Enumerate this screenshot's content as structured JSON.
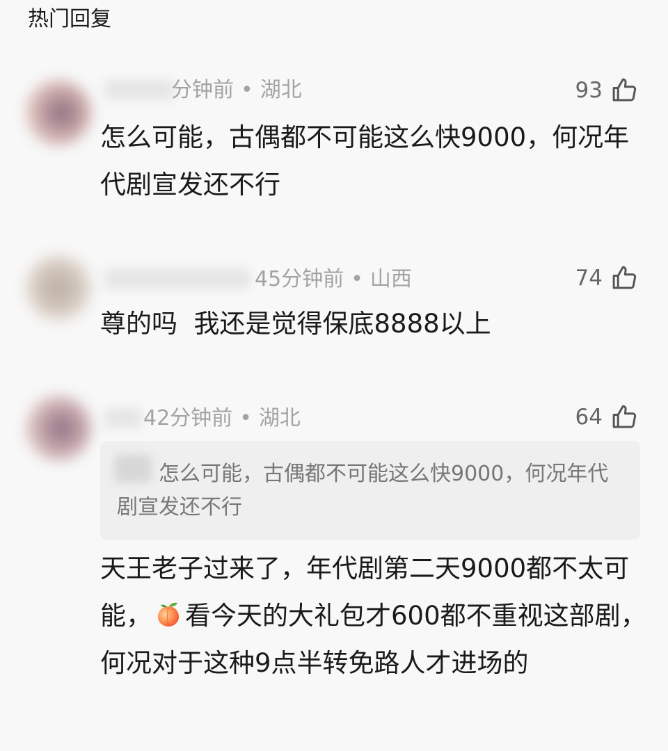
{
  "section_title": "热门回复",
  "comments": [
    {
      "time": "分钟前",
      "location": "湖北",
      "separator": "•",
      "likes": "93",
      "text": "怎么可能，古偶都不可能这么快9000，何况年代剧宣发还不行"
    },
    {
      "time": "45分钟前",
      "location": "山西",
      "separator": "•",
      "likes": "74",
      "text": "尊的吗  我还是觉得保底8888以上"
    },
    {
      "time": "42分钟前",
      "location": "湖北",
      "separator": "•",
      "likes": "64",
      "quote": "怎么可能，古偶都不可能这么快9000，何况年代剧宣发还不行",
      "text_part1": "天王老子过来了，年代剧第二天9000都不太可能，",
      "text_part2": "看今天的大礼包才600都不重视这部剧，何况对于这种9点半转免路人才进场的",
      "emoji": "peach-emoji"
    }
  ],
  "colors": {
    "meta_text": "#a3a3a3",
    "like_icon": "#555555",
    "quote_bg": "#efefef"
  },
  "icons": {
    "like": "thumbs-up-icon"
  }
}
